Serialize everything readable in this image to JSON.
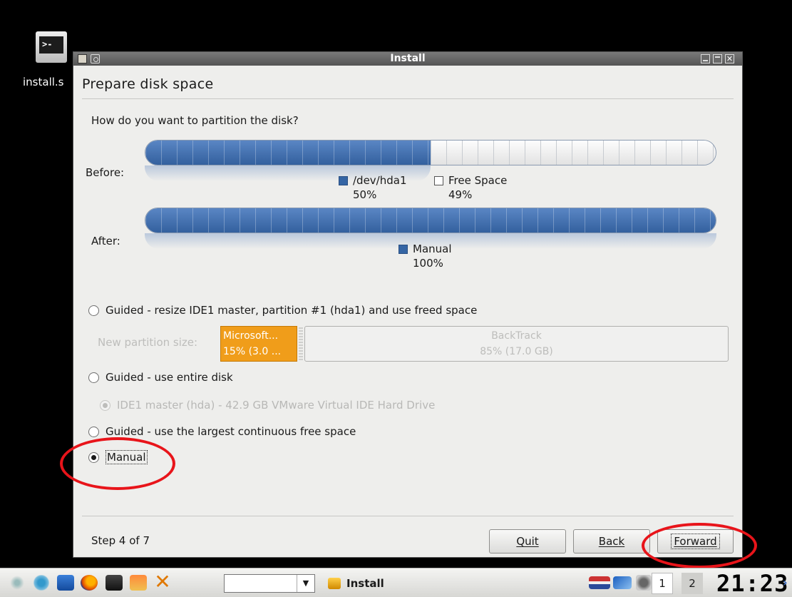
{
  "desktop": {
    "icon_label": "install.s",
    "icon_glyph": ">-"
  },
  "window": {
    "title": "Install",
    "heading": "Prepare disk space",
    "question": "How do you want to partition the disk?",
    "before": {
      "label": "Before:",
      "segments": [
        {
          "name": "/dev/hda1",
          "percent_text": "50%",
          "fraction": 0.5,
          "color": "#3565a4"
        },
        {
          "name": "Free Space",
          "percent_text": "49%",
          "fraction": 0.5,
          "color": "#ffffff"
        }
      ]
    },
    "after": {
      "label": "After:",
      "segments": [
        {
          "name": "Manual",
          "percent_text": "100%",
          "fraction": 1.0,
          "color": "#3565a4"
        }
      ]
    },
    "options": [
      {
        "label": "Guided - resize IDE1 master, partition #1 (hda1) and use freed space",
        "selected": false,
        "enabled": true
      },
      {
        "label": "Guided - use entire disk",
        "selected": false,
        "enabled": true
      },
      {
        "label": "Guided - use the largest continuous free space",
        "selected": false,
        "enabled": true
      },
      {
        "label": "Manual",
        "selected": true,
        "enabled": true
      }
    ],
    "resize": {
      "label": "New partition size:",
      "left": {
        "name": "Microsoft...",
        "size": "15% (3.0 ...",
        "fraction": 0.15
      },
      "right": {
        "name": "BackTrack",
        "size": "85% (17.0 GB)",
        "fraction": 0.85
      }
    },
    "disk_option": {
      "label": "IDE1 master (hda) - 42.9 GB VMware Virtual IDE Hard Drive",
      "selected": true,
      "enabled": false
    },
    "step": "Step 4 of 7",
    "buttons": {
      "quit": "Quit",
      "back": "Back",
      "forward": "Forward"
    }
  },
  "taskbar": {
    "task_label": "Install",
    "workspaces": [
      "1",
      "2"
    ],
    "clock": "21:23",
    "more": "›"
  },
  "colors": {
    "accent_blue": "#3565a4",
    "selected_orange": "#f09d1a",
    "annotation_red": "#e8141a"
  }
}
